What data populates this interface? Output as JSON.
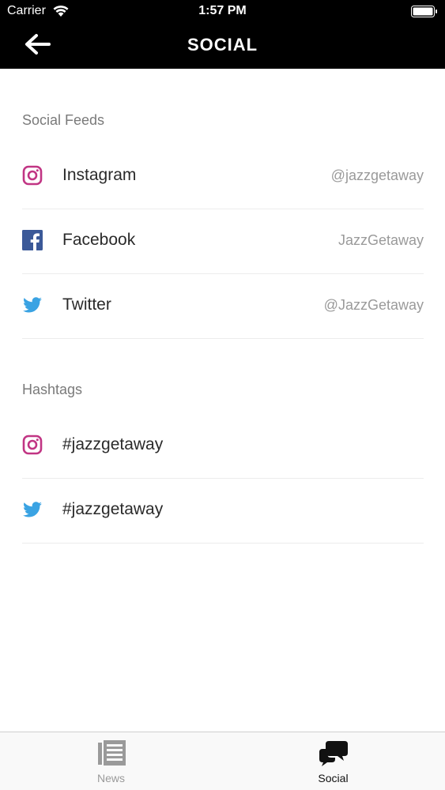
{
  "status_bar": {
    "carrier": "Carrier",
    "time": "1:57 PM"
  },
  "nav": {
    "title": "SOCIAL"
  },
  "social_feeds": {
    "header": "Social Feeds",
    "items": [
      {
        "label": "Instagram",
        "handle": "@jazzgetaway",
        "icon": "instagram-icon"
      },
      {
        "label": "Facebook",
        "handle": "JazzGetaway",
        "icon": "facebook-icon"
      },
      {
        "label": "Twitter",
        "handle": "@JazzGetaway",
        "icon": "twitter-icon"
      }
    ]
  },
  "hashtags": {
    "header": "Hashtags",
    "items": [
      {
        "label": "#jazzgetaway",
        "icon": "instagram-icon"
      },
      {
        "label": "#jazzgetaway",
        "icon": "twitter-icon"
      }
    ]
  },
  "tabbar": {
    "tabs": [
      {
        "label": "News",
        "icon": "news-icon",
        "active": false
      },
      {
        "label": "Social",
        "icon": "chat-bubbles-icon",
        "active": true
      }
    ]
  },
  "colors": {
    "instagram": "#c13584",
    "facebook": "#3b5998",
    "twitter": "#3aa3e3",
    "nav_background": "#000000"
  }
}
